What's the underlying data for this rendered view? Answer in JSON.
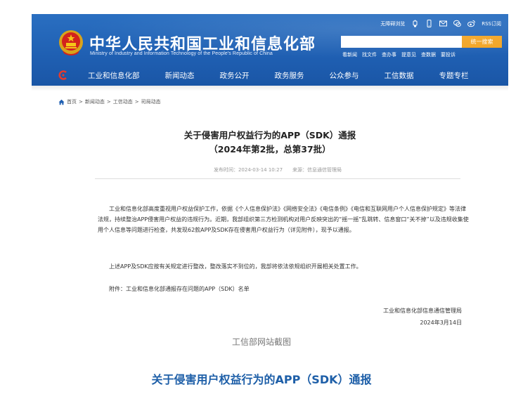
{
  "header": {
    "site_title": "中华人民共和国工业和信息化部",
    "site_subtitle": "Ministry of Industry and Information Technology of the People's Republic of China",
    "top_links": {
      "barrier_free": "无障碍浏览",
      "rss": "RSS订阅"
    },
    "search": {
      "placeholder": "",
      "button_label": "统一搜索"
    },
    "quick_links": [
      "看新闻",
      "找文件",
      "查办事",
      "提意见",
      "查数据",
      "要投诉"
    ],
    "nav": [
      "工业和信息化部",
      "新闻动态",
      "政务公开",
      "政务服务",
      "公众参与",
      "工信数据",
      "专题专栏"
    ]
  },
  "breadcrumb": [
    "首页",
    "新闻动态",
    "工信动态",
    "司局动态"
  ],
  "breadcrumb_sep": ">",
  "article": {
    "title": "关于侵害用户权益行为的APP（SDK）通报",
    "subtitle": "（2024年第2批，总第37批）",
    "publish_time": "发布时间：2024-03-14 10:27",
    "source": "来源：信息通信管理局",
    "paragraph1": "工业和信息化部高度重视用户权益保护工作，依据《个人信息保护法》《网络安全法》《电信条例》《电信和互联网用户个人信息保护规定》等法律法规，持续整治APP侵害用户权益的违规行为。近期，我部组织第三方检测机构对用户反映突出的“摇一摇”乱跳转、信息窗口“关不掉”以及违规收集使用个人信息等问题进行检查，共发现62款APP及SDK存在侵害用户权益行为（详见附件），现予以通报。",
    "paragraph2": "上述APP及SDK应按有关规定进行整改，整改落实不到位的，我部将依法依规组织开展相关处置工作。",
    "paragraph3": "附件：工业和信息化部通报存在问题的APP（SDK）名单",
    "sign_org": "工业和信息化部信息通信管理局",
    "sign_date": "2024年3月14日"
  },
  "caption": "工信部网站截图",
  "headline": "关于侵害用户权益行为的APP（SDK）通报",
  "colors": {
    "header_blue": "#1f5fb2",
    "search_orange": "#f2a423",
    "headline_blue": "#1e5fa8"
  }
}
